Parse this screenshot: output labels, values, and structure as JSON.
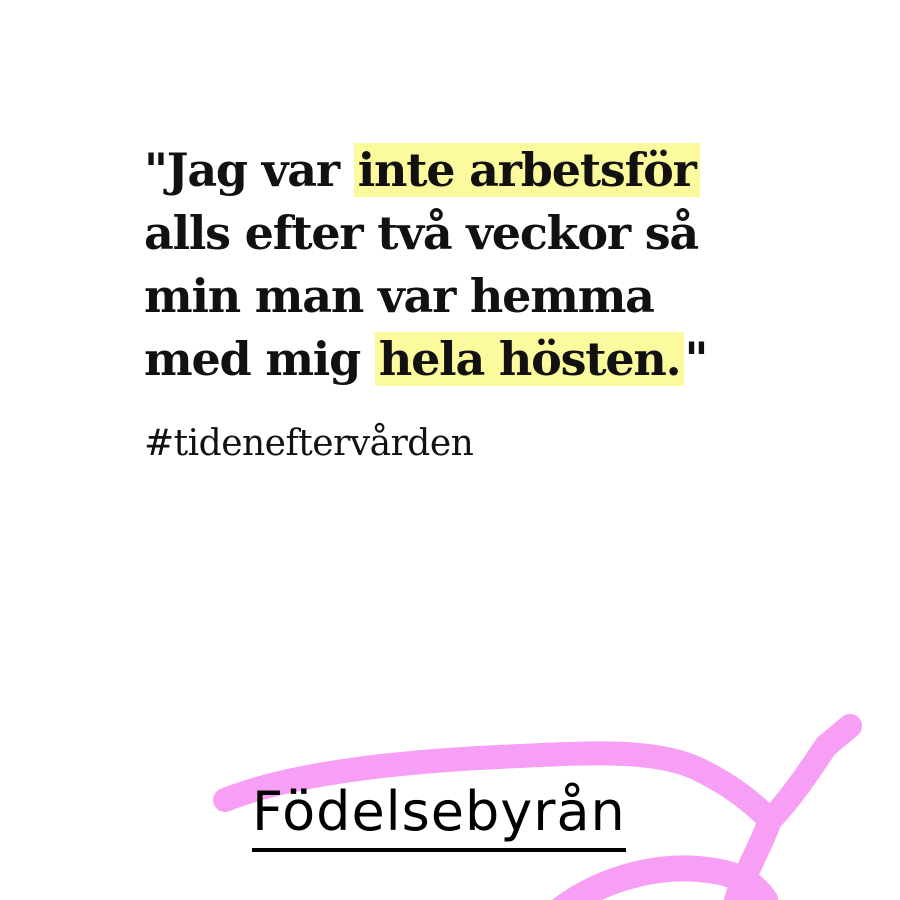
{
  "quote": {
    "line1_pre": "\"Jag var ",
    "line1_hl": "inte arbetsför",
    "line2": "alls efter två veckor så",
    "line3": "min man var hemma",
    "line4_pre": "med mig ",
    "line4_hl": "hela hösten.",
    "line4_post": "\""
  },
  "hashtag": "#tideneftervården",
  "logo": "Födelsebyrån",
  "colors": {
    "highlight": "#fbfb9e",
    "brush": "#f79ef5",
    "text": "#111111",
    "background": "#ffffff"
  }
}
